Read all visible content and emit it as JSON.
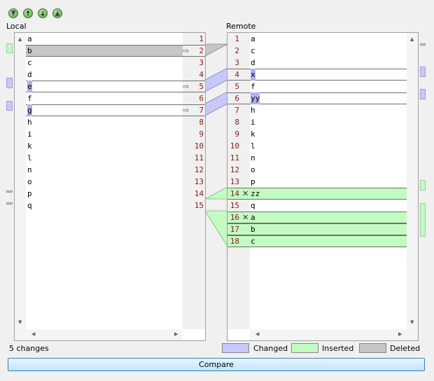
{
  "toolbar": {
    "buttons": [
      {
        "name": "first-change-button",
        "icon": "arrow-to-top-icon"
      },
      {
        "name": "previous-change-button",
        "icon": "arrow-up-icon"
      },
      {
        "name": "next-change-button",
        "icon": "arrow-down-icon"
      },
      {
        "name": "last-change-button",
        "icon": "arrow-to-bottom-icon"
      }
    ]
  },
  "local": {
    "title": "Local",
    "lines": [
      {
        "n": "1",
        "text": "a",
        "state": "none"
      },
      {
        "n": "2",
        "text": "b",
        "state": "deleted",
        "arrow": true
      },
      {
        "n": "3",
        "text": "c",
        "state": "none"
      },
      {
        "n": "4",
        "text": "d",
        "state": "none"
      },
      {
        "n": "5",
        "text": "e",
        "state": "changed",
        "arrow": true
      },
      {
        "n": "6",
        "text": "f",
        "state": "none"
      },
      {
        "n": "7",
        "text": "g",
        "state": "changed",
        "arrow": true
      },
      {
        "n": "8",
        "text": "h",
        "state": "none"
      },
      {
        "n": "9",
        "text": "i",
        "state": "none"
      },
      {
        "n": "10",
        "text": "k",
        "state": "none"
      },
      {
        "n": "11",
        "text": "l",
        "state": "none"
      },
      {
        "n": "12",
        "text": "n",
        "state": "none"
      },
      {
        "n": "13",
        "text": "o",
        "state": "none"
      },
      {
        "n": "14",
        "text": "p",
        "state": "none"
      },
      {
        "n": "15",
        "text": "q",
        "state": "none"
      }
    ]
  },
  "remote": {
    "title": "Remote",
    "lines": [
      {
        "n": "1",
        "text": "a",
        "state": "none"
      },
      {
        "n": "2",
        "text": "c",
        "state": "none"
      },
      {
        "n": "3",
        "text": "d",
        "state": "none"
      },
      {
        "n": "4",
        "text": "x",
        "state": "changed"
      },
      {
        "n": "5",
        "text": "f",
        "state": "none"
      },
      {
        "n": "6",
        "text": "yy",
        "state": "changed"
      },
      {
        "n": "7",
        "text": "h",
        "state": "none"
      },
      {
        "n": "8",
        "text": "i",
        "state": "none"
      },
      {
        "n": "9",
        "text": "k",
        "state": "none"
      },
      {
        "n": "10",
        "text": "l",
        "state": "none"
      },
      {
        "n": "11",
        "text": "n",
        "state": "none"
      },
      {
        "n": "12",
        "text": "o",
        "state": "none"
      },
      {
        "n": "13",
        "text": "p",
        "state": "none"
      },
      {
        "n": "14",
        "text": "zz",
        "state": "inserted",
        "mark": true
      },
      {
        "n": "15",
        "text": "q",
        "state": "none"
      },
      {
        "n": "16",
        "text": "a",
        "state": "inserted",
        "mark": true
      },
      {
        "n": "17",
        "text": "b",
        "state": "inserted"
      },
      {
        "n": "18",
        "text": "c",
        "state": "inserted"
      }
    ]
  },
  "status": {
    "changes": "5 changes"
  },
  "legend": {
    "changed": "Changed",
    "inserted": "Inserted",
    "deleted": "Deleted"
  },
  "compare_button": "Compare",
  "colors": {
    "changed": "#c8c8fb",
    "changed_text": "#b0b0f0",
    "inserted": "#c2fcc2",
    "deleted": "#c6c6c6",
    "line_number": "#8b1a1a",
    "arrow": "#2f6fb0"
  }
}
